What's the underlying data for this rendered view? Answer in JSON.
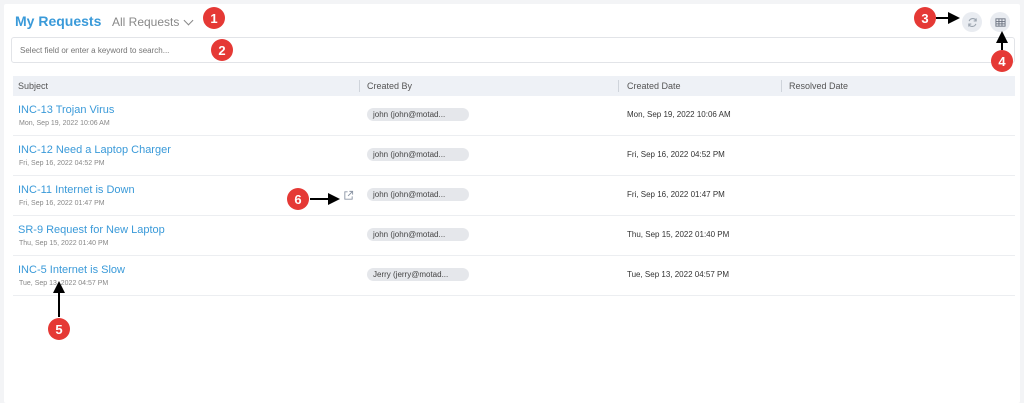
{
  "header": {
    "title": "My Requests",
    "view_label": "All Requests"
  },
  "search": {
    "placeholder": "Select field or enter a keyword to search..."
  },
  "table": {
    "columns": [
      "Subject",
      "Created By",
      "Created Date",
      "Resolved Date"
    ],
    "rows": [
      {
        "subject": "INC-13 Trojan Virus",
        "sub_date": "Mon, Sep 19, 2022 10:06 AM",
        "created_by": "john (john@motad...",
        "created_date": "Mon, Sep 19, 2022 10:06 AM",
        "resolved_date": ""
      },
      {
        "subject": "INC-12 Need a Laptop Charger",
        "sub_date": "Fri, Sep 16, 2022 04:52 PM",
        "created_by": "john (john@motad...",
        "created_date": "Fri, Sep 16, 2022 04:52 PM",
        "resolved_date": ""
      },
      {
        "subject": "INC-11 Internet is Down",
        "sub_date": "Fri, Sep 16, 2022 01:47 PM",
        "created_by": "john (john@motad...",
        "created_date": "Fri, Sep 16, 2022 01:47 PM",
        "resolved_date": ""
      },
      {
        "subject": "SR-9 Request for New Laptop",
        "sub_date": "Thu, Sep 15, 2022 01:40 PM",
        "created_by": "john (john@motad...",
        "created_date": "Thu, Sep 15, 2022 01:40 PM",
        "resolved_date": ""
      },
      {
        "subject": "INC-5 Internet is Slow",
        "sub_date": "Tue, Sep 13, 2022 04:57 PM",
        "created_by": "Jerry (jerry@motad...",
        "created_date": "Tue, Sep 13, 2022 04:57 PM",
        "resolved_date": ""
      }
    ]
  },
  "annotations": [
    "1",
    "2",
    "3",
    "4",
    "5",
    "6"
  ],
  "icons": [
    "chevron-down-icon",
    "refresh-icon",
    "grid-view-icon",
    "external-link-icon"
  ],
  "colors": {
    "accent": "#3a9ad9",
    "badge": "#e53935"
  }
}
